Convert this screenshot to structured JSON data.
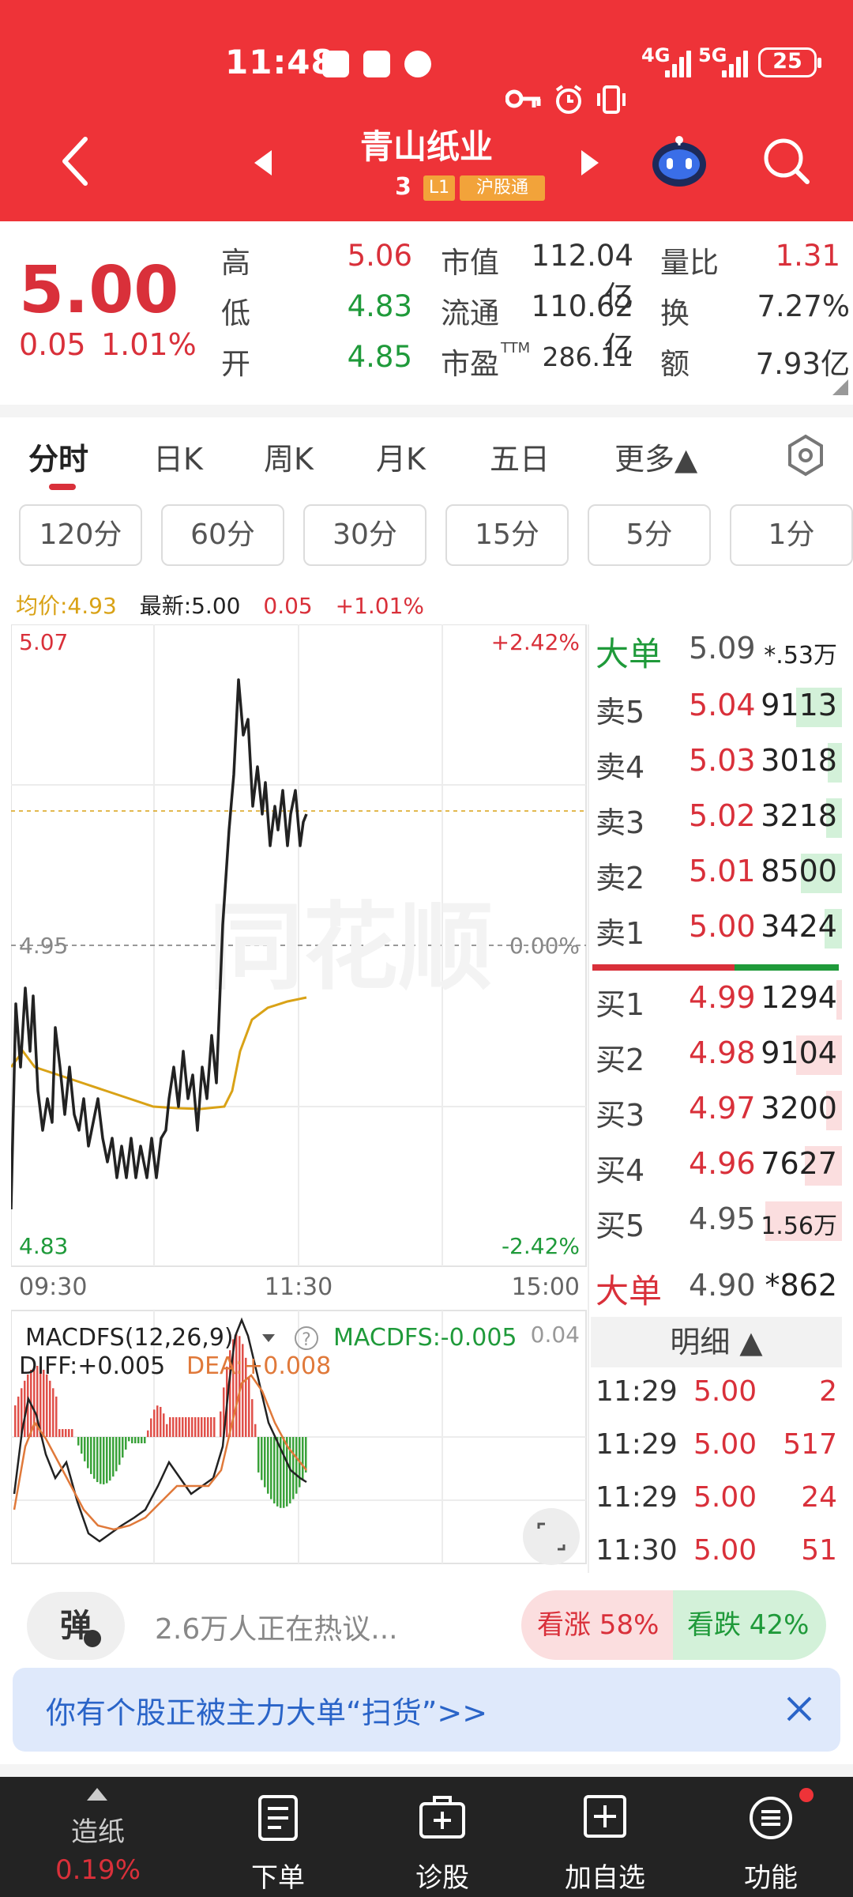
{
  "status": {
    "time": "11:48",
    "net1": "4G",
    "net2": "5G",
    "battery": "25"
  },
  "header": {
    "title": "青山纸业",
    "code_partial": "3",
    "level_badge": "L1",
    "connect_badge": "沪股通"
  },
  "quote": {
    "price": "5.00",
    "change": "0.05",
    "change_pct": "1.01%",
    "high_label": "高",
    "high": "5.06",
    "low_label": "低",
    "low": "4.83",
    "open_label": "开",
    "open": "4.85",
    "mktcap_label": "市值",
    "mktcap": "112.04亿",
    "float_label": "流通",
    "float": "110.62亿",
    "pe_label": "市盈",
    "pe_sup": "TTM",
    "pe": "286.11",
    "volratio_label": "量比",
    "volratio": "1.31",
    "turnover_label": "换",
    "turnover": "7.27%",
    "amount_label": "额",
    "amount": "7.93亿"
  },
  "tabs": [
    "分时",
    "日K",
    "周K",
    "月K",
    "五日",
    "更多▲"
  ],
  "periods": [
    "120分",
    "60分",
    "30分",
    "15分",
    "5分",
    "1分"
  ],
  "intraday": {
    "avg_label": "均价:4.93",
    "latest_label": "最新:5.00",
    "change": "0.05",
    "change_pct": "+1.01%",
    "price_top": "5.07",
    "price_mid": "4.95",
    "price_bottom": "4.83",
    "pct_top": "+2.42%",
    "pct_mid": "0.00%",
    "pct_bottom": "-2.42%",
    "time_start": "09:30",
    "time_mid": "11:30",
    "time_end": "15:00",
    "watermark": "同花顺"
  },
  "macd": {
    "title": "MACDFS(12,26,9)",
    "macdfs": "MACDFS:-0.005",
    "diff": "DIFF:+0.005",
    "dea": "DEA:+0.008",
    "axis_top": "0.04"
  },
  "orderbook": {
    "big_top": {
      "label": "大单",
      "price": "5.09",
      "vol": "*.53万"
    },
    "asks": [
      {
        "label": "卖5",
        "price": "5.04",
        "vol": "9113",
        "bar": 0.32
      },
      {
        "label": "卖4",
        "price": "5.03",
        "vol": "3018",
        "bar": 0.1
      },
      {
        "label": "卖3",
        "price": "5.02",
        "vol": "3218",
        "bar": 0.11
      },
      {
        "label": "卖2",
        "price": "5.01",
        "vol": "8500",
        "bar": 0.29
      },
      {
        "label": "卖1",
        "price": "5.00",
        "vol": "3424",
        "bar": 0.12
      }
    ],
    "bids": [
      {
        "label": "买1",
        "price": "4.99",
        "vol": "1294",
        "bar": 0.04
      },
      {
        "label": "买2",
        "price": "4.98",
        "vol": "9104",
        "bar": 0.32
      },
      {
        "label": "买3",
        "price": "4.97",
        "vol": "3200",
        "bar": 0.11
      },
      {
        "label": "买4",
        "price": "4.96",
        "vol": "7627",
        "bar": 0.26
      },
      {
        "label": "买5",
        "price": "4.95",
        "vol": "1.56万",
        "bar": 0.54
      }
    ],
    "big_bottom": {
      "label": "大单",
      "price": "4.90",
      "vol": "*862"
    },
    "detail_label": "明细 ▲",
    "trades": [
      {
        "time": "11:29",
        "price": "5.00",
        "vol": "2"
      },
      {
        "time": "11:29",
        "price": "5.00",
        "vol": "517"
      },
      {
        "time": "11:29",
        "price": "5.00",
        "vol": "24"
      },
      {
        "time": "11:30",
        "price": "5.00",
        "vol": "51"
      }
    ]
  },
  "social": {
    "danmaku": "弹",
    "discuss": "2.6万人正在热议...",
    "bull": "看涨 58%",
    "bear": "看跌 42%"
  },
  "banner": {
    "text": "你有个股正被主力大单“扫货”>>"
  },
  "nav": {
    "sector": "造纸",
    "sector_pct": "0.19%",
    "items": [
      "下单",
      "诊股",
      "加自选",
      "功能"
    ]
  },
  "colors": {
    "red": "#d9303a",
    "green": "#1f9a3a",
    "header": "#ee3338",
    "avg_line": "#d9a216",
    "dea": "#e0793a"
  }
}
